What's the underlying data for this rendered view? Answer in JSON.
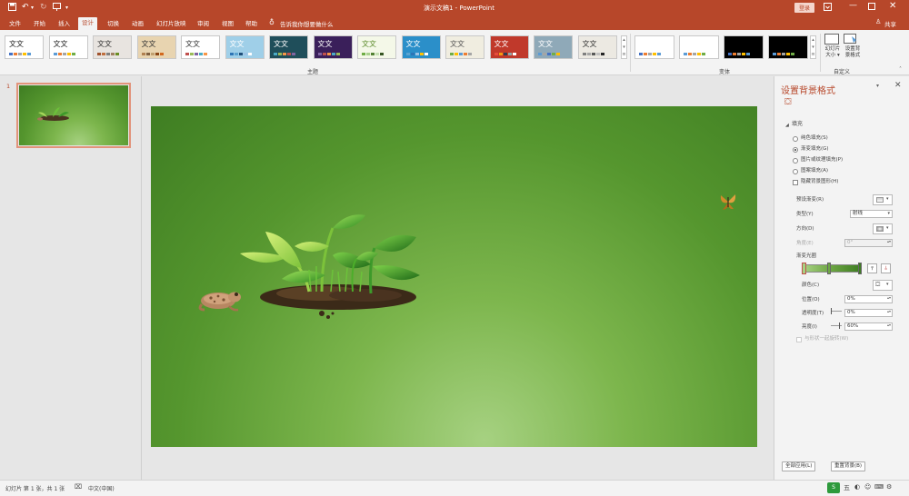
{
  "window": {
    "title": "演示文稿1  -  PowerPoint",
    "login_label": "登录",
    "share_label": "共享"
  },
  "quick_access": [
    "save-icon",
    "undo-icon",
    "redo-icon",
    "start-presentation-icon",
    "customize-icon"
  ],
  "tabs": [
    {
      "label": "文件",
      "active": false
    },
    {
      "label": "开始",
      "active": false
    },
    {
      "label": "插入",
      "active": false
    },
    {
      "label": "设计",
      "active": true
    },
    {
      "label": "切换",
      "active": false
    },
    {
      "label": "动画",
      "active": false
    },
    {
      "label": "幻灯片放映",
      "active": false
    },
    {
      "label": "审阅",
      "active": false
    },
    {
      "label": "视图",
      "active": false
    },
    {
      "label": "帮助",
      "active": false
    }
  ],
  "tell_me": "告诉我你想要做什么",
  "ribbon": {
    "themes_group_label": "主题",
    "variants_group_label": "变体",
    "customize_group_label": "自定义",
    "theme_sample_text": "文文",
    "themes": [
      {
        "bg": "#ffffff",
        "fg": "#222222",
        "colors": [
          "#4472c4",
          "#ed7d31",
          "#a5a5a5",
          "#ffc000",
          "#5b9bd5"
        ]
      },
      {
        "bg": "#ffffff",
        "fg": "#222222",
        "colors": [
          "#5b9bd5",
          "#ed7d31",
          "#a5a5a5",
          "#ffc000",
          "#70ad47"
        ]
      },
      {
        "bg": "#e8e4e0",
        "fg": "#333333",
        "colors": [
          "#a0522d",
          "#c07040",
          "#808080",
          "#a08060",
          "#6b8e23"
        ]
      },
      {
        "bg": "#e8d4b0",
        "fg": "#333333",
        "colors": [
          "#b08050",
          "#806040",
          "#c0a070",
          "#8b4513",
          "#d2691e"
        ]
      },
      {
        "bg": "#ffffff",
        "fg": "#333333",
        "colors": [
          "#c0504d",
          "#9bbb59",
          "#8064a2",
          "#4bacc6",
          "#f79646"
        ]
      },
      {
        "bg": "#9fcfe8",
        "fg": "#ffffff",
        "colors": [
          "#2e75b6",
          "#5ba3d0",
          "#1f4e79",
          "#9dc3e6",
          "#ffffff"
        ]
      },
      {
        "bg": "#1f4e5a",
        "fg": "#ffffff",
        "colors": [
          "#4bacc6",
          "#9bbb59",
          "#f79646",
          "#c0504d",
          "#8064a2"
        ]
      },
      {
        "bg": "#3a1f5a",
        "fg": "#ffffff",
        "colors": [
          "#8064a2",
          "#c0504d",
          "#f79646",
          "#4bacc6",
          "#9bbb59"
        ]
      },
      {
        "bg": "#f4f8e8",
        "fg": "#5a8a2a",
        "colors": [
          "#70ad47",
          "#a9d18e",
          "#548235",
          "#c5e0b4",
          "#375623"
        ]
      },
      {
        "bg": "#2b8fc9",
        "fg": "#ffffff",
        "colors": [
          "#5ba3d0",
          "#2e75b6",
          "#9dc3e6",
          "#ffc000",
          "#ffffff"
        ]
      },
      {
        "bg": "#f0ede0",
        "fg": "#555555",
        "colors": [
          "#70ad47",
          "#ffc000",
          "#5b9bd5",
          "#ed7d31",
          "#a5a5a5"
        ]
      },
      {
        "bg": "#c0392b",
        "fg": "#ffffff",
        "colors": [
          "#e74c3c",
          "#f39c12",
          "#2c3e50",
          "#95a5a6",
          "#ffffff"
        ]
      },
      {
        "bg": "#8fa9b8",
        "fg": "#ffffff",
        "colors": [
          "#5b9bd5",
          "#a5a5a5",
          "#4472c4",
          "#70ad47",
          "#ffc000"
        ]
      },
      {
        "bg": "#ece9e2",
        "fg": "#333333",
        "colors": [
          "#7f7f7f",
          "#a5a5a5",
          "#595959",
          "#bfbfbf",
          "#262626"
        ]
      }
    ],
    "variants": [
      {
        "bg": "#ffffff",
        "colors": [
          "#4472c4",
          "#ed7d31",
          "#a5a5a5",
          "#ffc000",
          "#5b9bd5"
        ]
      },
      {
        "bg": "#ffffff",
        "colors": [
          "#5b9bd5",
          "#ed7d31",
          "#a5a5a5",
          "#ffc000",
          "#70ad47"
        ]
      },
      {
        "bg": "#000000",
        "colors": [
          "#4472c4",
          "#ed7d31",
          "#a5a5a5",
          "#ffc000",
          "#5b9bd5"
        ]
      },
      {
        "bg": "#000000",
        "colors": [
          "#5b9bd5",
          "#ed7d31",
          "#a5a5a5",
          "#ffc000",
          "#70ad47"
        ]
      }
    ],
    "slide_size_label": "幻灯片\n大小 ▾",
    "format_bg_label": "设置背\n景格式"
  },
  "thumbnail": {
    "number": "1"
  },
  "panel": {
    "title": "设置背景格式",
    "fill_section": "填充",
    "options": [
      {
        "label": "纯色填充(S)",
        "selected": false
      },
      {
        "label": "渐变填充(G)",
        "selected": true
      },
      {
        "label": "图片或纹理填充(P)",
        "selected": false
      },
      {
        "label": "图案填充(A)",
        "selected": false
      }
    ],
    "hide_bg_label": "隐藏背景图形(H)",
    "preset_label": "预设渐变(R)",
    "type_label": "类型(Y)",
    "type_value": "射线",
    "direction_label": "方向(D)",
    "angle_label": "角度(E)",
    "angle_value": "0°",
    "stops_label": "渐变光圈",
    "color_label": "颜色(C)",
    "position_label": "位置(O)",
    "position_value": "0%",
    "transparency_label": "透明度(T)",
    "transparency_value": "0%",
    "brightness_label": "亮度(I)",
    "brightness_value": "60%",
    "rotate_label": "与形状一起旋转(W)",
    "apply_all_label": "全部应用(L)",
    "reset_label": "重置背景(B)"
  },
  "status": {
    "slide_info": "幻灯片 第 1 张，共 1 张",
    "language": "中文(中国)"
  },
  "colors": {
    "accent": "#b7472a",
    "ribbon": "#f3f3f3",
    "gradient_stop": "#4d8a2c"
  }
}
